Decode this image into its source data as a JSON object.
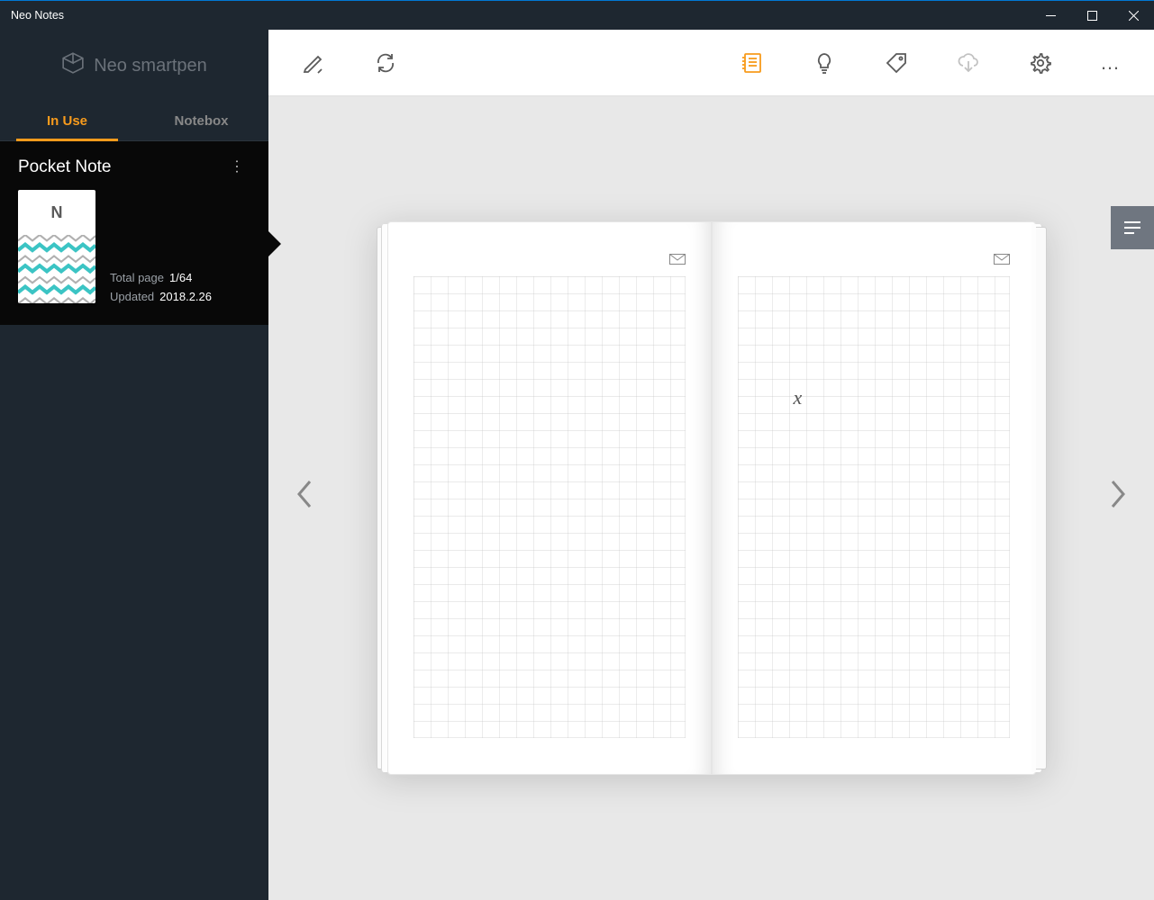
{
  "window": {
    "title": "Neo Notes"
  },
  "brand": {
    "text": "Neo smartpen"
  },
  "sidebar": {
    "tabs": [
      {
        "label": "In Use",
        "active": true
      },
      {
        "label": "Notebox",
        "active": false
      }
    ],
    "notebook": {
      "title": "Pocket Note",
      "cover_letter": "N",
      "meta": [
        {
          "label": "Total page",
          "value": "1/64"
        },
        {
          "label": "Updated",
          "value": "2018.2.26"
        }
      ]
    }
  },
  "toolbar": {
    "items_left": [
      "pen-icon",
      "sync-icon"
    ],
    "items_right": [
      "notebook-icon",
      "idea-icon",
      "tag-icon",
      "cloud-download-icon",
      "settings-icon",
      "more-icon"
    ],
    "active_item": "notebook-icon",
    "disabled_items": [
      "cloud-download-icon"
    ]
  },
  "viewer": {
    "handwriting": "x",
    "side_tab": "text-lines-icon"
  },
  "colors": {
    "accent": "#f89b1c",
    "sidebar_bg": "#1e2730",
    "card_bg": "#080808",
    "content_bg": "#e8e8e8"
  }
}
